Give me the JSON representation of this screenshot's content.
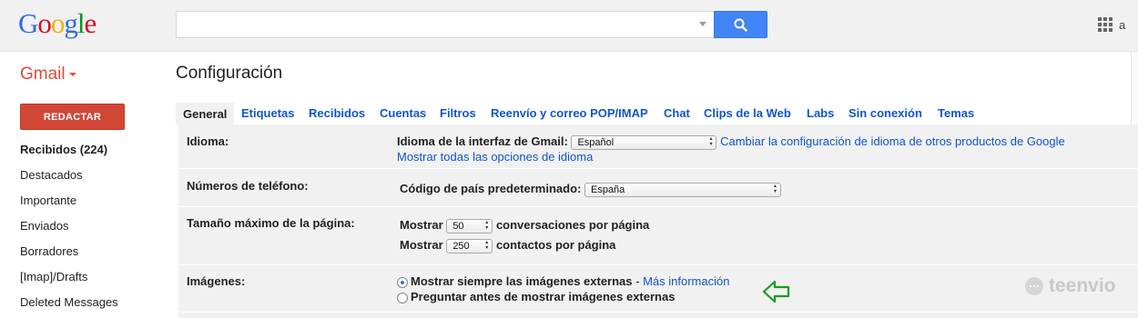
{
  "header": {
    "logo_letters": [
      {
        "ch": "G",
        "color": "#3369e8"
      },
      {
        "ch": "o",
        "color": "#d50f25"
      },
      {
        "ch": "o",
        "color": "#eeb211"
      },
      {
        "ch": "g",
        "color": "#3369e8"
      },
      {
        "ch": "l",
        "color": "#009925"
      },
      {
        "ch": "e",
        "color": "#d50f25"
      }
    ],
    "search_value": "",
    "search_placeholder": "",
    "search_icon": "search-icon",
    "apps_icon": "apps-grid-icon",
    "user_initial": "a"
  },
  "product": {
    "label": "Gmail"
  },
  "page": {
    "title": "Configuración"
  },
  "sidebar": {
    "compose_label": "REDACTAR",
    "items": [
      {
        "label": "Recibidos (224)",
        "bold": true
      },
      {
        "label": "Destacados",
        "bold": false
      },
      {
        "label": "Importante",
        "bold": false
      },
      {
        "label": "Enviados",
        "bold": false
      },
      {
        "label": "Borradores",
        "bold": false
      },
      {
        "label": "[Imap]/Drafts",
        "bold": false
      },
      {
        "label": "Deleted Messages",
        "bold": false
      }
    ]
  },
  "tabs": [
    {
      "label": "General",
      "active": true
    },
    {
      "label": "Etiquetas"
    },
    {
      "label": "Recibidos"
    },
    {
      "label": "Cuentas"
    },
    {
      "label": "Filtros"
    },
    {
      "label": "Reenvío y correo POP/IMAP"
    },
    {
      "label": "Chat"
    },
    {
      "label": "Clips de la Web"
    },
    {
      "label": "Labs"
    },
    {
      "label": "Sin conexión"
    },
    {
      "label": "Temas"
    }
  ],
  "settings": {
    "language": {
      "label": "Idioma:",
      "interface_label": "Idioma de la interfaz de Gmail:",
      "selected": "Español",
      "change_link": "Cambiar la configuración de idioma de otros productos de Google",
      "show_all_link": "Mostrar todas las opciones de idioma"
    },
    "phone": {
      "label": "Números de teléfono:",
      "country_label": "Código de país predeterminado:",
      "selected": "España"
    },
    "page_size": {
      "label": "Tamaño máximo de la página:",
      "show_label_1": "Mostrar",
      "conversations_value": "50",
      "conversations_suffix": "conversaciones por página",
      "show_label_2": "Mostrar",
      "contacts_value": "250",
      "contacts_suffix": "contactos por página"
    },
    "images": {
      "label": "Imágenes:",
      "option_always": "Mostrar siempre las imágenes externas",
      "separator": " - ",
      "more_info_link": "Más información",
      "option_ask": "Preguntar antes de mostrar imágenes externas",
      "selected": "always"
    }
  },
  "annotation": {
    "arrow_color": "#1a9e1a",
    "arrow_icon": "left-arrow-icon"
  },
  "watermark": {
    "text": "teenvio"
  },
  "colors": {
    "link": "#1155cc",
    "compose": "#d14836",
    "gmail": "#dd4b39",
    "search_button": "#4285f4"
  }
}
